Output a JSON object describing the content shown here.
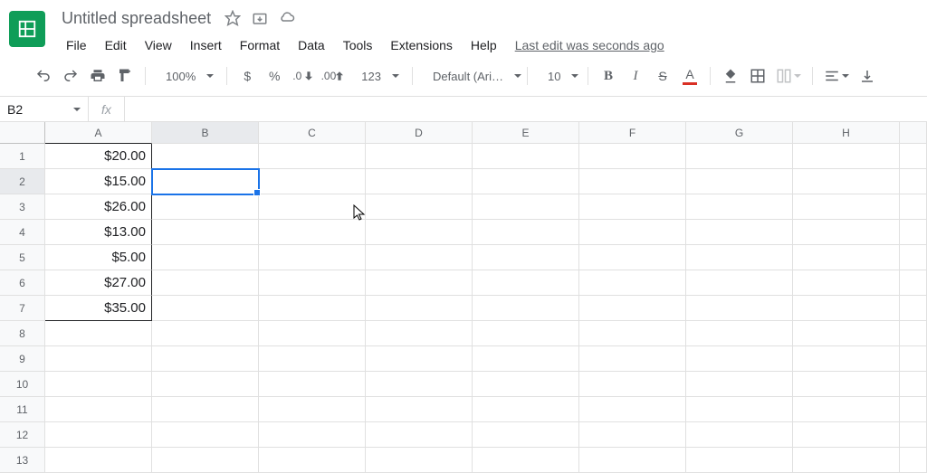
{
  "header": {
    "title": "Untitled spreadsheet",
    "last_edit": "Last edit was seconds ago"
  },
  "menus": [
    "File",
    "Edit",
    "View",
    "Insert",
    "Format",
    "Data",
    "Tools",
    "Extensions",
    "Help"
  ],
  "toolbar": {
    "zoom": "100%",
    "currency": "$",
    "percent": "%",
    "dec_dec": ".0",
    "inc_dec": ".00",
    "more_formats": "123",
    "font": "Default (Ari…",
    "font_size": "10",
    "bold": "B",
    "italic": "I",
    "strike": "S",
    "text_color": "A"
  },
  "formula_bar": {
    "cell_ref": "B2",
    "fx": "fx",
    "value": ""
  },
  "columns": [
    "A",
    "B",
    "C",
    "D",
    "E",
    "F",
    "G",
    "H"
  ],
  "rows": [
    "1",
    "2",
    "3",
    "4",
    "5",
    "6",
    "7",
    "8",
    "9",
    "10",
    "11",
    "12",
    "13"
  ],
  "selected_cell": "B2",
  "cell_data": {
    "A1": "$20.00",
    "A2": "$15.00",
    "A3": "$26.00",
    "A4": "$13.00",
    "A5": "$5.00",
    "A6": "$27.00",
    "A7": "$35.00"
  },
  "colors": {
    "accent": "#1a73e8",
    "brand": "#0f9d58",
    "text_color_bar": "#d93025"
  }
}
